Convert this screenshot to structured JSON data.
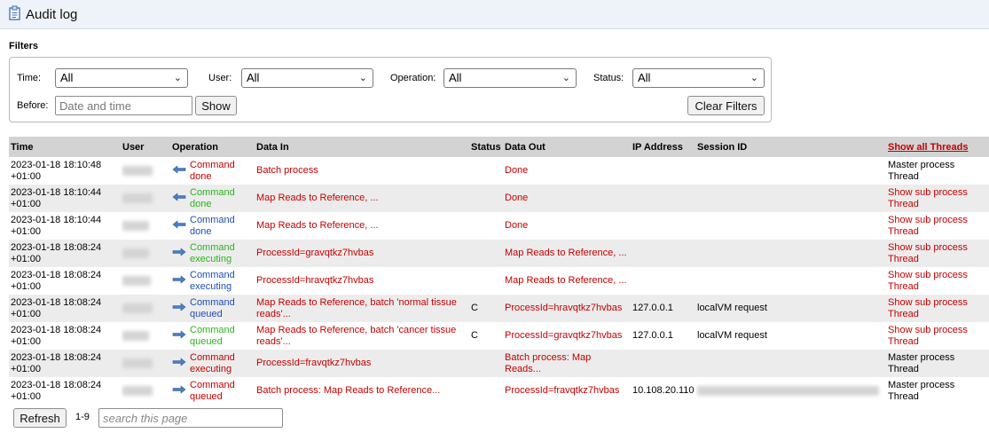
{
  "window": {
    "title": "Audit log"
  },
  "filters": {
    "heading": "Filters",
    "time": {
      "label": "Time:",
      "value": "All"
    },
    "user": {
      "label": "User:",
      "value": "All"
    },
    "operation": {
      "label": "Operation:",
      "value": "All"
    },
    "status": {
      "label": "Status:",
      "value": "All"
    },
    "before": {
      "label": "Before:",
      "placeholder": "Date and time"
    },
    "show_label": "Show",
    "clear_label": "Clear Filters"
  },
  "table": {
    "headers": [
      "Time",
      "User",
      "Operation",
      "Data In",
      "Status",
      "Data Out",
      "IP Address",
      "Session ID"
    ],
    "show_all_threads": "Show all Threads",
    "rows": [
      {
        "time": "2023-01-18 18:10:48 +01:00",
        "direction": "in",
        "operation": "Command done",
        "op_color": "red",
        "data_in": "Batch process",
        "status": "",
        "data_out": "Done",
        "ip": "",
        "session": "",
        "thread": "Master process Thread",
        "thread_color": "black"
      },
      {
        "time": "2023-01-18 18:10:44 +01:00",
        "direction": "in",
        "operation": "Command done",
        "op_color": "green",
        "data_in": "Map Reads to Reference, ...",
        "status": "",
        "data_out": "Done",
        "ip": "",
        "session": "",
        "thread": "Show sub process Thread",
        "thread_color": "red"
      },
      {
        "time": "2023-01-18 18:10:44 +01:00",
        "direction": "in",
        "operation": "Command done",
        "op_color": "blue",
        "data_in": "Map Reads to Reference, ...",
        "status": "",
        "data_out": "Done",
        "ip": "",
        "session": "",
        "thread": "Show sub process Thread",
        "thread_color": "red"
      },
      {
        "time": "2023-01-18 18:08:24 +01:00",
        "direction": "out",
        "operation": "Command executing",
        "op_color": "green",
        "data_in": "ProcessId=gravqtkz7hvbas",
        "status": "",
        "data_out": "Map Reads to Reference, ...",
        "ip": "",
        "session": "",
        "thread": "Show sub process Thread",
        "thread_color": "red"
      },
      {
        "time": "2023-01-18 18:08:24 +01:00",
        "direction": "out",
        "operation": "Command executing",
        "op_color": "blue",
        "data_in": "ProcessId=hravqtkz7hvbas",
        "status": "",
        "data_out": "Map Reads to Reference, ...",
        "ip": "",
        "session": "",
        "thread": "Show sub process Thread",
        "thread_color": "red"
      },
      {
        "time": "2023-01-18 18:08:24 +01:00",
        "direction": "out",
        "operation": "Command queued",
        "op_color": "blue",
        "data_in": "Map Reads to Reference, batch 'normal tissue reads'...",
        "status": "C",
        "data_out": "ProcessId=hravqtkz7hvbas",
        "ip": "127.0.0.1",
        "session": "localVM request",
        "thread": "Show sub process Thread",
        "thread_color": "red"
      },
      {
        "time": "2023-01-18 18:08:24 +01:00",
        "direction": "out",
        "operation": "Command queued",
        "op_color": "green",
        "data_in": "Map Reads to Reference, batch 'cancer tissue reads'...",
        "status": "C",
        "data_out": "ProcessId=gravqtkz7hvbas",
        "ip": "127.0.0.1",
        "session": "localVM request",
        "thread": "Show sub process Thread",
        "thread_color": "red"
      },
      {
        "time": "2023-01-18 18:08:24 +01:00",
        "direction": "out",
        "operation": "Command executing",
        "op_color": "red",
        "data_in": "ProcessId=fravqtkz7hvbas",
        "status": "",
        "data_out": "Batch process: Map Reads...",
        "ip": "",
        "session": "",
        "thread": "Master process Thread",
        "thread_color": "black"
      },
      {
        "time": "2023-01-18 18:08:24 +01:00",
        "direction": "out",
        "operation": "Command queued",
        "op_color": "red",
        "data_in": "Batch process: Map Reads to Reference...",
        "status": "",
        "data_out": "ProcessId=fravqtkz7hvbas",
        "ip": "10.108.20.110",
        "session": "",
        "thread": "Master process Thread",
        "thread_color": "black"
      }
    ]
  },
  "footer": {
    "refresh_label": "Refresh",
    "range": "1-9",
    "search_placeholder": "search this page"
  },
  "icons": {
    "title": "clipboard-icon",
    "in": "arrow-left-icon",
    "out": "arrow-right-icon"
  },
  "colors": {
    "red": "#c40000",
    "green": "#2bb51d",
    "blue": "#1f4fb4",
    "arrow": "#4a7fc1"
  }
}
